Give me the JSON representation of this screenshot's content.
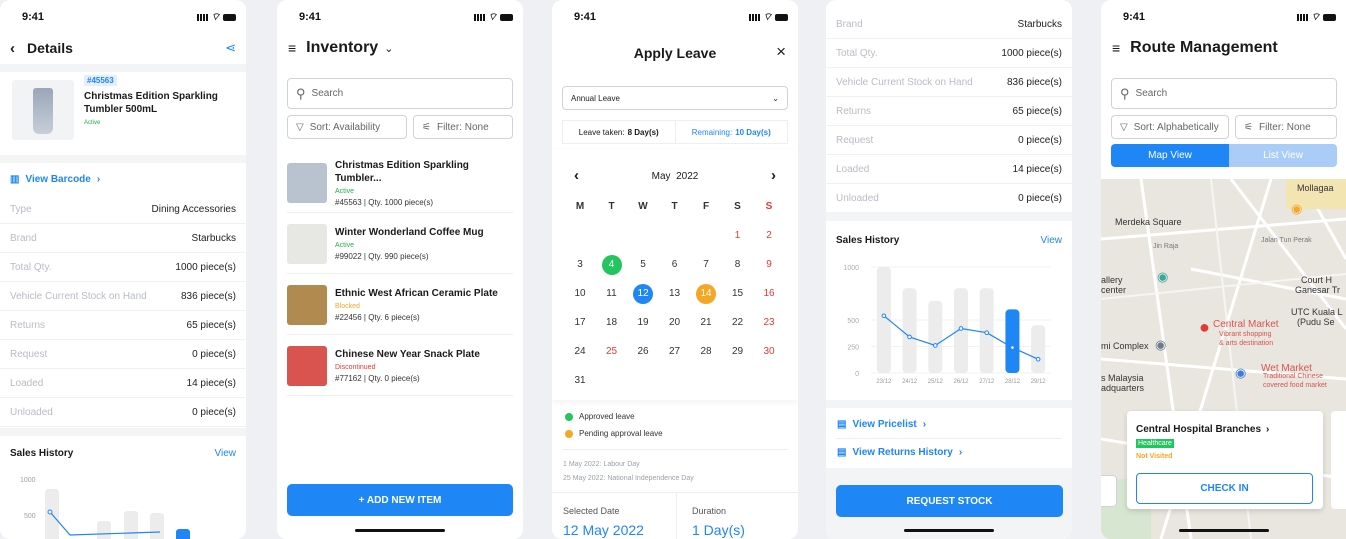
{
  "status_time": "9:41",
  "details": {
    "title": "Details",
    "sku": "#45563",
    "name": "Christmas Edition Sparkling Tumbler 500mL",
    "status": "Active",
    "barcode_link": "View Barcode",
    "rows": [
      {
        "k": "Type",
        "v": "Dining Accessories"
      },
      {
        "k": "Brand",
        "v": "Starbucks"
      },
      {
        "k": "Total Qty.",
        "v": "1000 piece(s)"
      },
      {
        "k": "Vehicle Current Stock on Hand",
        "v": "836 piece(s)"
      },
      {
        "k": "Returns",
        "v": "65 piece(s)"
      },
      {
        "k": "Request",
        "v": "0 piece(s)"
      },
      {
        "k": "Loaded",
        "v": "14 piece(s)"
      },
      {
        "k": "Unloaded",
        "v": "0 piece(s)"
      }
    ],
    "sales_title": "Sales History",
    "sales_view": "View",
    "y_ticks": [
      "1000",
      "500"
    ]
  },
  "inventory": {
    "title": "Inventory",
    "search_placeholder": "Search",
    "sort": "Sort: Availability",
    "filter": "Filter: None",
    "items": [
      {
        "name": "Christmas Edition Sparkling Tumbler...",
        "status": "Active",
        "status_color": "#22b04b",
        "meta": "#45563 | Qty. 1000 piece(s)",
        "thumb": "#b9c3cf"
      },
      {
        "name": "Winter Wonderland Coffee Mug",
        "status": "Active",
        "status_color": "#22b04b",
        "meta": "#99022 | Qty. 990 piece(s)",
        "thumb": "#e7e7e3"
      },
      {
        "name": "Ethnic West African Ceramic Plate",
        "status": "Blocked",
        "status_color": "#f5a623",
        "meta": "#22456 | Qty. 6 piece(s)",
        "thumb": "#b08a4e"
      },
      {
        "name": "Chinese New Year Snack Plate",
        "status": "Discontinued",
        "status_color": "#e53935",
        "meta": "#77162 | Qty. 0 piece(s)",
        "thumb": "#d9534f"
      }
    ],
    "add_button": "+ ADD NEW ITEM"
  },
  "leave": {
    "title": "Apply Leave",
    "type": "Annual Leave",
    "taken_label": "Leave taken:",
    "taken_value": "8 Day(s)",
    "remaining_label": "Remaining:",
    "remaining_value": "10 Day(s)",
    "month": "May  2022",
    "weekdays": [
      "M",
      "T",
      "W",
      "T",
      "F",
      "S",
      "S"
    ],
    "days": [
      [
        "",
        "",
        "",
        "",
        "",
        "1",
        "2"
      ],
      [
        "3",
        "4",
        "5",
        "6",
        "7",
        "8",
        "9"
      ],
      [
        "10",
        "11",
        "12",
        "13",
        "14",
        "15",
        "16"
      ],
      [
        "17",
        "18",
        "19",
        "20",
        "21",
        "22",
        "23"
      ],
      [
        "24",
        "25",
        "26",
        "27",
        "28",
        "29",
        "30"
      ],
      [
        "31",
        "",
        "",
        "",
        "",
        "",
        ""
      ]
    ],
    "approved_label": "Approved leave",
    "pending_label": "Pending approval leave",
    "holiday1": "1 May 2022: Labour Day",
    "holiday2": "25 May 2022: National Independence Day",
    "selected_label": "Selected Date",
    "selected_value": "12 May 2022",
    "duration_label": "Duration",
    "duration_value": "1 Day(s)",
    "colors": {
      "approved": "#22c55e",
      "pending": "#f5a623",
      "selected": "#1e86f5",
      "holiday": "#e53935"
    }
  },
  "stock": {
    "rows": [
      {
        "k": "Brand",
        "v": "Starbucks"
      },
      {
        "k": "Total Qty.",
        "v": "1000 piece(s)"
      },
      {
        "k": "Vehicle Current Stock on Hand",
        "v": "836 piece(s)"
      },
      {
        "k": "Returns",
        "v": "65 piece(s)"
      },
      {
        "k": "Request",
        "v": "0 piece(s)"
      },
      {
        "k": "Loaded",
        "v": "14 piece(s)"
      },
      {
        "k": "Unloaded",
        "v": "0 piece(s)"
      }
    ],
    "sales_title": "Sales History",
    "sales_view": "View",
    "pricelist_link": "View Pricelist",
    "returns_link": "View Returns History",
    "request_button": "REQUEST STOCK"
  },
  "chart_data": {
    "type": "bar",
    "title": "Sales History",
    "categories": [
      "23/12",
      "24/12",
      "25/12",
      "26/12",
      "27/12",
      "28/12",
      "29/12"
    ],
    "series": [
      {
        "values": [
          1000,
          800,
          680,
          800,
          800,
          600,
          450
        ]
      },
      {
        "values": [
          540,
          340,
          260,
          420,
          380,
          240,
          130
        ]
      }
    ],
    "ylim": [
      0,
      1000
    ],
    "y_ticks": [
      "1000",
      "500",
      "250",
      "0"
    ],
    "highlight": "28/12"
  },
  "route": {
    "title": "Route Management",
    "search_placeholder": "Search",
    "sort": "Sort: Alphabetically",
    "filter": "Filter: None",
    "tab_map": "Map View",
    "tab_list": "List View",
    "map_labels": [
      "Merdeka Square",
      "Mollagaa",
      "Central Market",
      "Vibrant shopping",
      "& arts destination",
      "Wet Market",
      "Traditional Chinese",
      "covered food market",
      "Court H",
      "Ganesar Tr",
      "UTC Kuala L",
      "(Pudu Se",
      "mi Complex",
      "s Malaysia",
      "adquarters",
      "Jalan Tun Perak",
      "Jin Raja",
      "allery",
      "center"
    ],
    "card_title": "Central Hospital Branches",
    "card_tag": "Healthcare",
    "card_status": "Not Visited",
    "check_in": "CHECK IN"
  }
}
